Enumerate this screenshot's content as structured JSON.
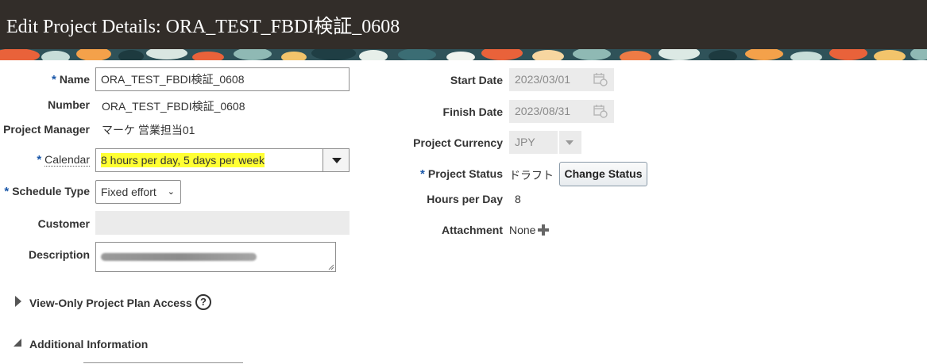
{
  "header": {
    "title": "Edit Project Details: ORA_TEST_FBDI検証_0608"
  },
  "left_form": {
    "name": {
      "required": "*",
      "label": "Name",
      "value": "ORA_TEST_FBDI検証_0608"
    },
    "number": {
      "label": "Number",
      "value": "ORA_TEST_FBDI検証_0608"
    },
    "project_manager": {
      "label": "Project Manager",
      "value": "マーケ 営業担当01"
    },
    "calendar": {
      "required": "*",
      "label": "Calendar",
      "value": "8 hours per day, 5 days per week"
    },
    "schedule_type": {
      "required": "*",
      "label": "Schedule Type",
      "value": "Fixed effort"
    },
    "customer": {
      "label": "Customer",
      "value": ""
    },
    "description": {
      "label": "Description",
      "value": ""
    }
  },
  "right_form": {
    "start_date": {
      "label": "Start Date",
      "value": "2023/03/01"
    },
    "finish_date": {
      "label": "Finish Date",
      "value": "2023/08/31"
    },
    "project_currency": {
      "label": "Project Currency",
      "value": "JPY"
    },
    "project_status": {
      "required": "*",
      "label": "Project Status",
      "value": "ドラフト",
      "button": "Change Status"
    },
    "hours_per_day": {
      "label": "Hours per Day",
      "value": "8"
    },
    "attachment": {
      "label": "Attachment",
      "value": "None"
    }
  },
  "sections": {
    "view_only": {
      "label": "View-Only Project Plan Access",
      "help": "?"
    },
    "additional": {
      "label": "Additional Information"
    }
  },
  "colors": {
    "title_bar": "#322d29",
    "required_star": "#1a57a8",
    "highlight": "#ffff33"
  }
}
